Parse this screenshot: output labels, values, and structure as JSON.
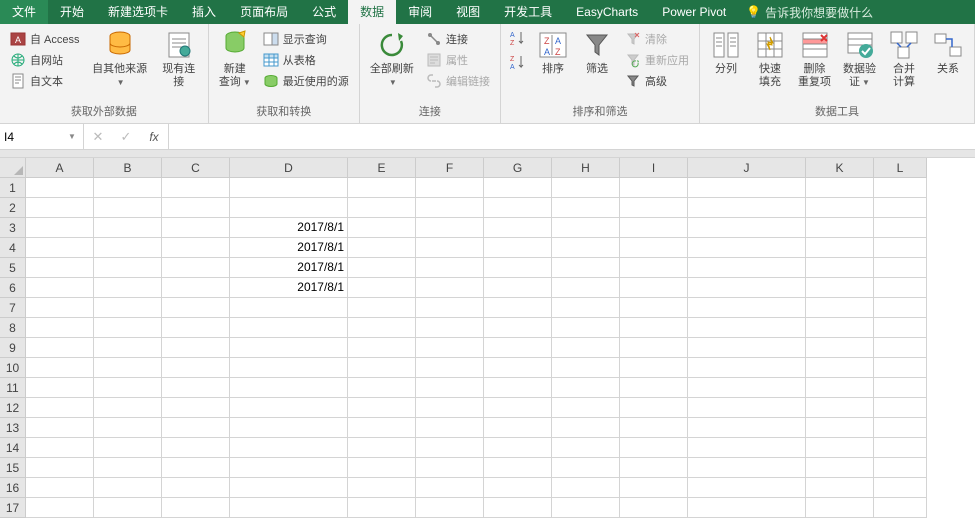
{
  "tabs": {
    "file": "文件",
    "home": "开始",
    "new_tab": "新建选项卡",
    "insert": "插入",
    "page_layout": "页面布局",
    "formulas": "公式",
    "data": "数据",
    "review": "审阅",
    "view": "视图",
    "developer": "开发工具",
    "easycharts": "EasyCharts",
    "powerpivot": "Power Pivot",
    "tell_me": "告诉我你想要做什么"
  },
  "ribbon": {
    "external_data": {
      "from_access": "自 Access",
      "from_web": "自网站",
      "from_text": "自文本",
      "from_other": "自其他来源",
      "existing": "现有连接",
      "group": "获取外部数据"
    },
    "get_transform": {
      "new_query": "新建\n查询",
      "show_queries": "显示查询",
      "from_table": "从表格",
      "recent_sources": "最近使用的源",
      "group": "获取和转换"
    },
    "connections": {
      "refresh_all": "全部刷新",
      "connections": "连接",
      "properties": "属性",
      "edit_links": "编辑链接",
      "group": "连接"
    },
    "sort_filter": {
      "sort_asc": "A↓Z",
      "sort_desc": "Z↓A",
      "sort": "排序",
      "filter": "筛选",
      "clear": "清除",
      "reapply": "重新应用",
      "advanced": "高级",
      "group": "排序和筛选"
    },
    "data_tools": {
      "text_to_columns": "分列",
      "flash_fill": "快速填充",
      "remove_dupes": "删除\n重复项",
      "data_validation": "数据验\n证",
      "consolidate": "合并计算",
      "relationships": "关系",
      "group": "数据工具"
    }
  },
  "formula_bar": {
    "name_box": "I4",
    "formula": ""
  },
  "sheet": {
    "columns": [
      {
        "label": "A",
        "width": 68
      },
      {
        "label": "B",
        "width": 68
      },
      {
        "label": "C",
        "width": 68
      },
      {
        "label": "D",
        "width": 118
      },
      {
        "label": "E",
        "width": 68
      },
      {
        "label": "F",
        "width": 68
      },
      {
        "label": "G",
        "width": 68
      },
      {
        "label": "H",
        "width": 68
      },
      {
        "label": "I",
        "width": 68
      },
      {
        "label": "J",
        "width": 118
      },
      {
        "label": "K",
        "width": 68
      },
      {
        "label": "L",
        "width": 53
      }
    ],
    "row_count": 17,
    "cells": {
      "D3": "2017/8/1",
      "D4": "2017/8/1",
      "D5": "2017/8/1",
      "D6": "2017/8/1"
    }
  }
}
